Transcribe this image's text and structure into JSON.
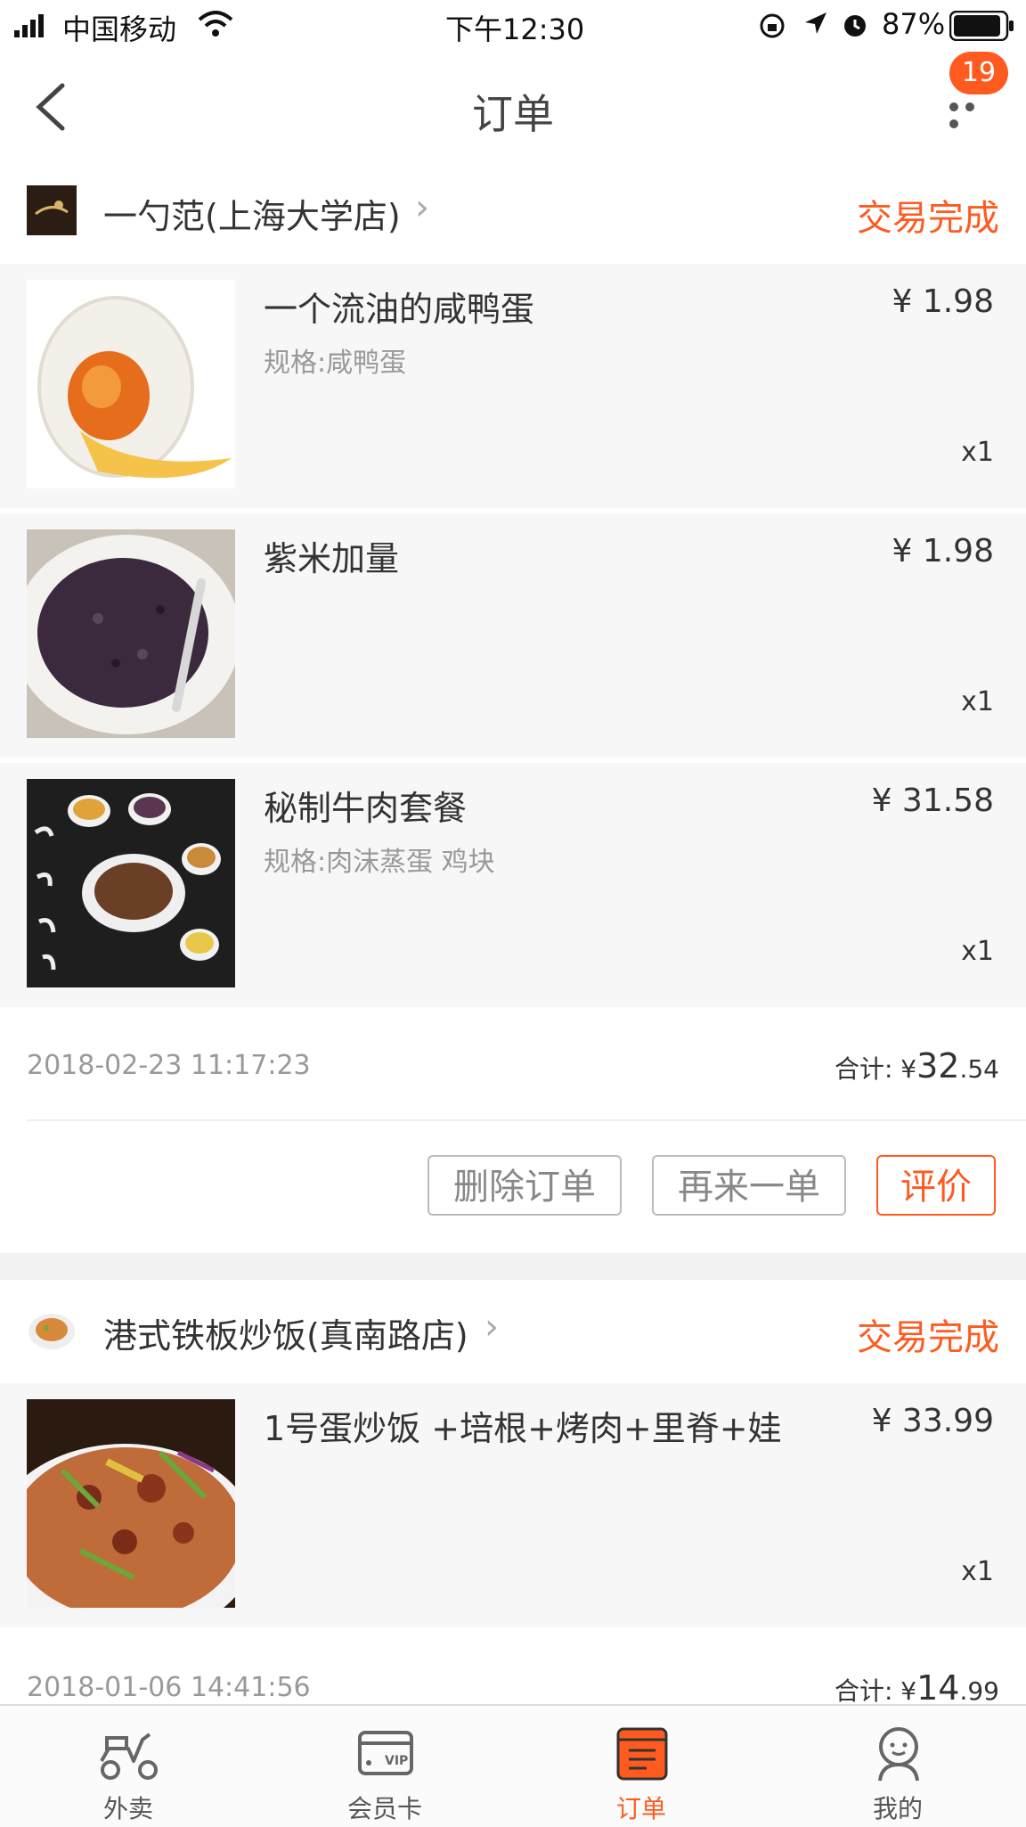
{
  "status_bar": {
    "carrier": "中国移动",
    "time": "下午12:30",
    "battery": "87%"
  },
  "nav": {
    "title": "订单",
    "badge_count": "19"
  },
  "orders": [
    {
      "shop": "一勺范(上海大学店)",
      "status": "交易完成",
      "items": [
        {
          "name": "一个流油的咸鸭蛋",
          "spec": "规格:咸鸭蛋",
          "price": "¥ 1.98",
          "qty": "x1"
        },
        {
          "name": "紫米加量",
          "spec": "",
          "price": "¥ 1.98",
          "qty": "x1"
        },
        {
          "name": "秘制牛肉套餐",
          "spec": "规格:肉沫蒸蛋 鸡块",
          "price": "¥ 31.58",
          "qty": "x1"
        }
      ],
      "date": "2018-02-23 11:17:23",
      "total_label": "合计: ¥",
      "total_int": "32",
      "total_dec": ".54",
      "buttons": {
        "delete": "删除订单",
        "reorder": "再来一单",
        "review": "评价"
      }
    },
    {
      "shop": "港式铁板炒饭(真南路店)",
      "status": "交易完成",
      "items": [
        {
          "name": "1号蛋炒饭 +培根+烤肉+里脊+娃",
          "spec": "",
          "price": "¥ 33.99",
          "qty": "x1"
        }
      ],
      "date": "2018-01-06 14:41:56",
      "total_label": "合计: ¥",
      "total_int": "14",
      "total_dec": ".99"
    }
  ],
  "tabbar": {
    "tabs": [
      {
        "label": "外卖",
        "icon": "scooter-icon"
      },
      {
        "label": "会员卡",
        "icon": "vip-card-icon"
      },
      {
        "label": "订单",
        "icon": "order-list-icon"
      },
      {
        "label": "我的",
        "icon": "profile-icon"
      }
    ]
  },
  "colors": {
    "accent": "#ff5a1f",
    "muted": "#999999",
    "background": "#f2f2f2"
  }
}
